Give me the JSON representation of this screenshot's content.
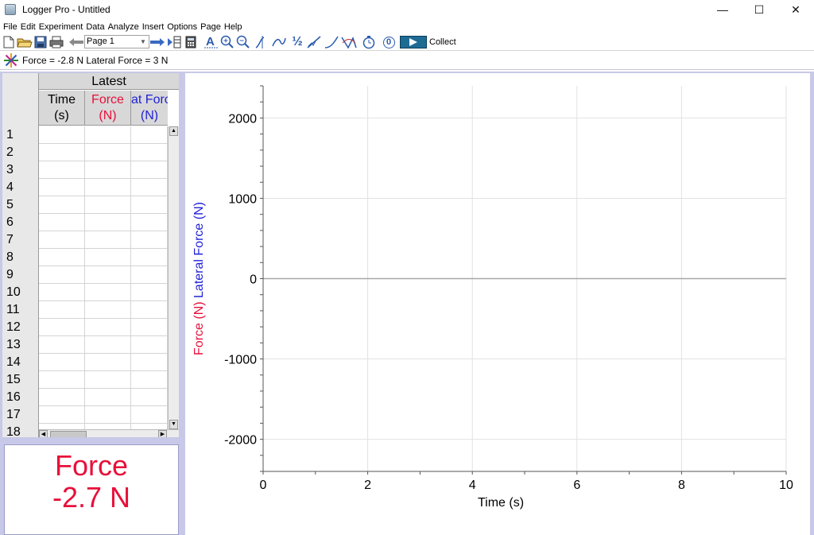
{
  "window": {
    "title": "Logger Pro - Untitled",
    "minimize": "—",
    "maximize": "☐",
    "close": "✕"
  },
  "menu": [
    "File",
    "Edit",
    "Experiment",
    "Data",
    "Analyze",
    "Insert",
    "Options",
    "Page",
    "Help"
  ],
  "toolbar": {
    "page_select": "Page 1",
    "collect_label": "Collect",
    "icons": [
      "new-file-icon",
      "open-folder-icon",
      "save-icon",
      "print-icon",
      "back-arrow-icon",
      "forward-arrow-icon",
      "data-browser-icon",
      "calculator-icon",
      "autoscale-icon",
      "zoom-in-icon",
      "zoom-out-icon",
      "examine-icon",
      "tangent-icon",
      "integral-icon",
      "linear-fit-icon",
      "curve-fit-icon",
      "model-icon",
      "stopwatch-icon",
      "zero-icon",
      "play-icon"
    ],
    "half_label": "½",
    "zero_label": "0"
  },
  "meter_bar": {
    "text": "Force = -2.8 N Lateral Force = 3 N"
  },
  "table": {
    "group_header": "Latest",
    "columns": [
      {
        "name": "Time",
        "unit": "(s)",
        "color": "#000000"
      },
      {
        "name": "Force",
        "unit": "(N)",
        "color": "#e8103a"
      },
      {
        "name": "at Forc",
        "unit": "(N)",
        "color": "#1f1fd8"
      }
    ],
    "rows": [
      "1",
      "2",
      "3",
      "4",
      "5",
      "6",
      "7",
      "8",
      "9",
      "10",
      "11",
      "12",
      "13",
      "14",
      "15",
      "16",
      "17",
      "18"
    ]
  },
  "meter_box": {
    "name": "Force",
    "value": "-2.7 N"
  },
  "chart_data": {
    "type": "line",
    "xlabel": "Time (s)",
    "ylabel_parts": [
      {
        "text": "Force (N)",
        "color": "#e8103a"
      },
      {
        "text": "Lateral Force (N)",
        "color": "#1f1fd8"
      }
    ],
    "xlim": [
      0,
      10
    ],
    "ylim": [
      -2400,
      2400
    ],
    "x_ticks": [
      0,
      2,
      4,
      6,
      8,
      10
    ],
    "y_ticks": [
      2000,
      1000,
      0,
      -1000,
      -2000
    ],
    "grid": true,
    "series": []
  }
}
